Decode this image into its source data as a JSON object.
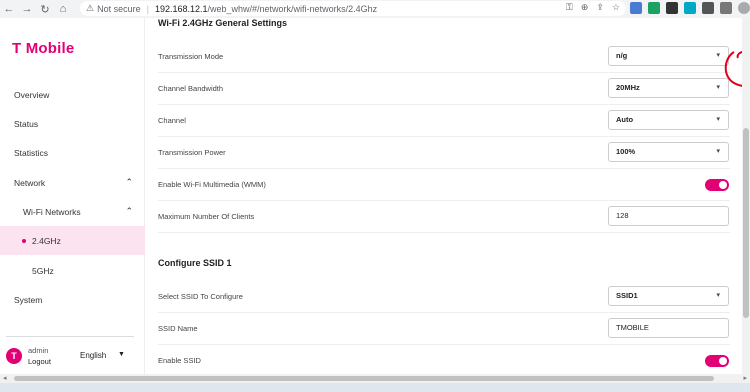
{
  "browser": {
    "security_label": "Not secure",
    "url_host": "192.168.12.1",
    "url_path": "/web_whw/#/network/wifi-networks/2.4Ghz"
  },
  "sidebar": {
    "logo": "T Mobile",
    "items": [
      {
        "label": "Overview"
      },
      {
        "label": "Status"
      },
      {
        "label": "Statistics"
      },
      {
        "label": "Network"
      },
      {
        "label": "Wi-Fi Networks"
      },
      {
        "label": "2.4GHz"
      },
      {
        "label": "5GHz"
      },
      {
        "label": "System"
      }
    ],
    "user": {
      "name": "admin",
      "logout": "Logout",
      "language": "English"
    }
  },
  "main": {
    "general_title": "Wi-Fi 2.4GHz General Settings",
    "settings": [
      {
        "label": "Transmission Mode",
        "type": "select",
        "value": "n/g"
      },
      {
        "label": "Channel Bandwidth",
        "type": "select",
        "value": "20MHz"
      },
      {
        "label": "Channel",
        "type": "select",
        "value": "Auto"
      },
      {
        "label": "Transmission Power",
        "type": "select",
        "value": "100%"
      },
      {
        "label": "Enable Wi-Fi Multimedia (WMM)",
        "type": "toggle",
        "value": true
      },
      {
        "label": "Maximum Number Of Clients",
        "type": "input",
        "value": "128"
      }
    ],
    "ssid_title": "Configure SSID 1",
    "ssid_settings": [
      {
        "label": "Select SSID To Configure",
        "type": "select",
        "value": "SSID1"
      },
      {
        "label": "SSID Name",
        "type": "input",
        "value": "TMOBILE"
      },
      {
        "label": "Enable SSID",
        "type": "toggle",
        "value": true
      }
    ]
  },
  "colors": {
    "brand": "#e20074",
    "annotation": "#e0001b",
    "active_bg": "#fbe3ef"
  },
  "icons": [
    "back-icon",
    "forward-icon",
    "reload-icon",
    "home-icon",
    "warning-icon",
    "key-icon",
    "zoom-icon",
    "share-icon",
    "star-icon",
    "chevron-up-icon",
    "chevron-down-icon",
    "caret-down-icon"
  ]
}
